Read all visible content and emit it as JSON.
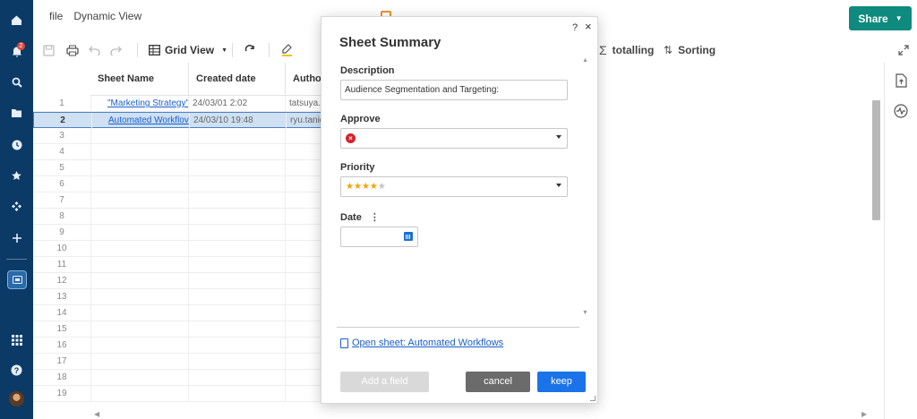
{
  "menu": {
    "file": "file",
    "dynamic_view": "Dynamic View"
  },
  "share": {
    "label": "Share"
  },
  "toolbar": {
    "grid_view": "Grid View",
    "totalling": "totalling",
    "sorting": "Sorting"
  },
  "notifications": {
    "count": "2"
  },
  "columns": {
    "sheet_name": "Sheet Name",
    "created_date": "Created date",
    "author": "Author"
  },
  "rows": [
    {
      "num": "1",
      "name": "\"Marketing Strategy\"",
      "created": "24/03/01 2:02",
      "author": "tatsuya.s"
    },
    {
      "num": "2",
      "name": "Automated Workflov",
      "created": "24/03/10 19:48",
      "author": "ryu.tanig"
    },
    {
      "num": "3"
    },
    {
      "num": "4"
    },
    {
      "num": "5"
    },
    {
      "num": "6"
    },
    {
      "num": "7"
    },
    {
      "num": "8"
    },
    {
      "num": "9"
    },
    {
      "num": "10"
    },
    {
      "num": "11"
    },
    {
      "num": "12"
    },
    {
      "num": "13"
    },
    {
      "num": "14"
    },
    {
      "num": "15"
    },
    {
      "num": "16"
    },
    {
      "num": "17"
    },
    {
      "num": "18"
    },
    {
      "num": "19"
    }
  ],
  "modal": {
    "title": "Sheet Summary",
    "help": "?",
    "close": "×",
    "description_label": "Description",
    "description_value": "Audience Segmentation and Targeting:",
    "approve_label": "Approve",
    "approve_symbol": "×",
    "priority_label": "Priority",
    "priority_rating": 4,
    "priority_max": 5,
    "date_label": "Date",
    "date_value": "",
    "open_sheet_link": "Open sheet: Automated Workflows",
    "add_field_label": "Add a field",
    "cancel_label": "cancel",
    "keep_label": "keep"
  },
  "colors": {
    "nav_bg": "#0b3a66",
    "share_bg": "#0e8a7e",
    "keep_bg": "#1a73e8",
    "cancel_bg": "#6b6b6b",
    "link": "#1a5fc9"
  }
}
